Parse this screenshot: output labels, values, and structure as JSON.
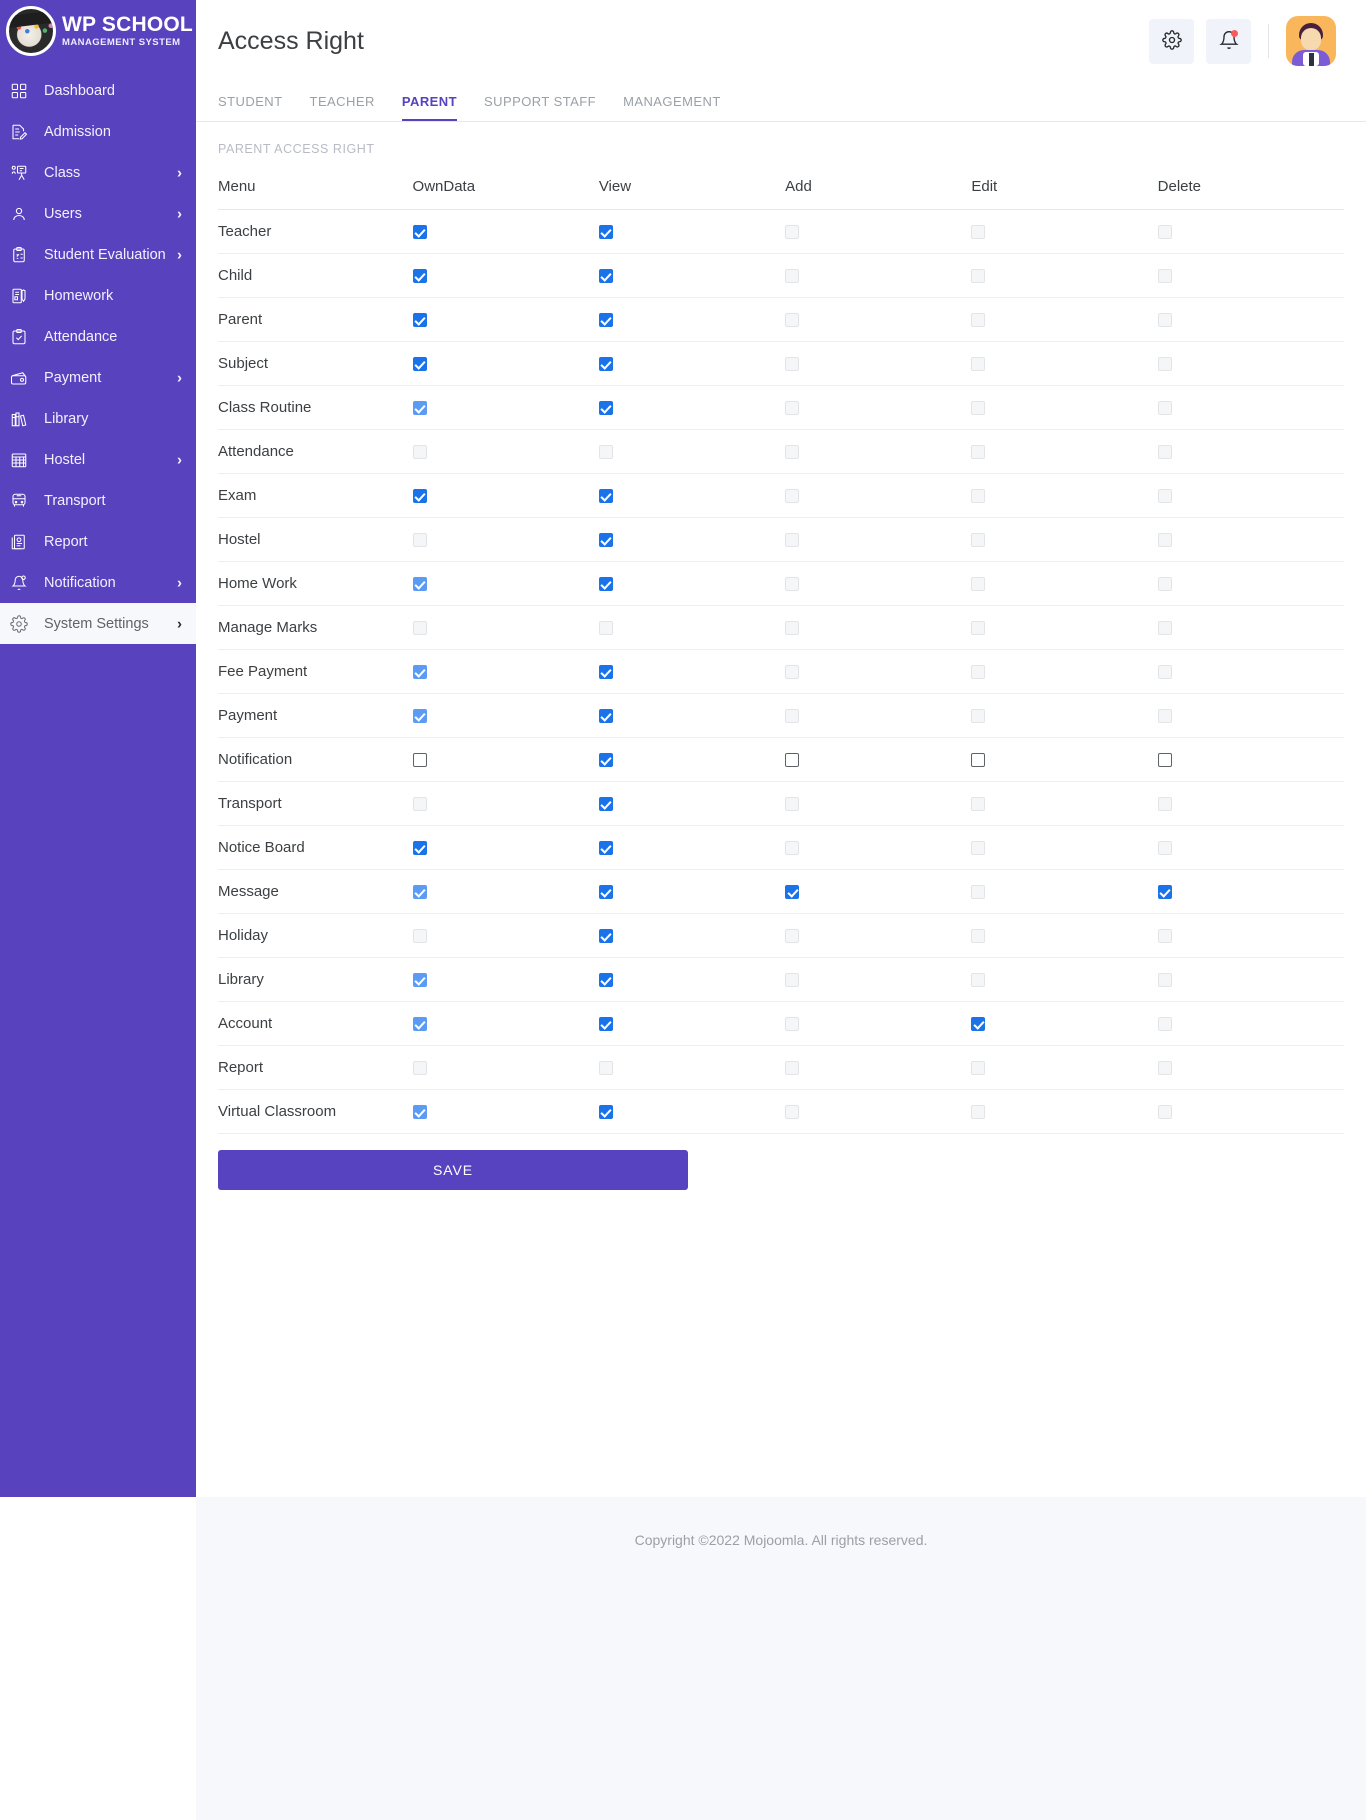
{
  "brand": {
    "title": "WP SCHOOL",
    "subtitle": "MANAGEMENT SYSTEM",
    "logo_icon": "graduation-cap-logo"
  },
  "sidebar": {
    "items": [
      {
        "label": "Dashboard",
        "icon": "grid-icon",
        "chevron": "",
        "active": false
      },
      {
        "label": "Admission",
        "icon": "document-pen-icon",
        "chevron": "",
        "active": false
      },
      {
        "label": "Class",
        "icon": "classroom-icon",
        "chevron": "›",
        "active": false
      },
      {
        "label": "Users",
        "icon": "user-icon",
        "chevron": "›",
        "active": false
      },
      {
        "label": "Student Evaluation",
        "icon": "clipboard-check-icon",
        "chevron": "›",
        "active": false
      },
      {
        "label": "Homework",
        "icon": "book-pen-icon",
        "chevron": "",
        "active": false
      },
      {
        "label": "Attendance",
        "icon": "clipboard-tick-icon",
        "chevron": "",
        "active": false
      },
      {
        "label": "Payment",
        "icon": "wallet-icon",
        "chevron": "›",
        "active": false
      },
      {
        "label": "Library",
        "icon": "books-icon",
        "chevron": "",
        "active": false
      },
      {
        "label": "Hostel",
        "icon": "hostel-icon",
        "chevron": "›",
        "active": false
      },
      {
        "label": "Transport",
        "icon": "bus-icon",
        "chevron": "",
        "active": false
      },
      {
        "label": "Report",
        "icon": "report-chart-icon",
        "chevron": "",
        "active": false
      },
      {
        "label": "Notification",
        "icon": "bell-icon",
        "chevron": "›",
        "active": false
      },
      {
        "label": "System Settings",
        "icon": "gear-icon",
        "chevron": "›",
        "active": true
      }
    ]
  },
  "header": {
    "title": "Access Right",
    "settings_icon": "gear-icon",
    "notification_icon": "bell-icon",
    "has_notification_dot": true,
    "avatar_icon": "user-avatar"
  },
  "tabs": [
    {
      "label": "STUDENT",
      "active": false
    },
    {
      "label": "TEACHER",
      "active": false
    },
    {
      "label": "PARENT",
      "active": true
    },
    {
      "label": "SUPPORT STAFF",
      "active": false
    },
    {
      "label": "MANAGEMENT",
      "active": false
    }
  ],
  "section_label": "PARENT ACCESS RIGHT",
  "table": {
    "columns": [
      "Menu",
      "OwnData",
      "View",
      "Add",
      "Edit",
      "Delete"
    ],
    "rows": [
      {
        "menu": "Teacher",
        "cells": [
          "checked",
          "checked",
          "off",
          "off",
          "off"
        ]
      },
      {
        "menu": "Child",
        "cells": [
          "checked",
          "checked",
          "off",
          "off",
          "off"
        ]
      },
      {
        "menu": "Parent",
        "cells": [
          "checked",
          "checked",
          "off",
          "off",
          "off"
        ]
      },
      {
        "menu": "Subject",
        "cells": [
          "checked",
          "checked",
          "off",
          "off",
          "off"
        ]
      },
      {
        "menu": "Class Routine",
        "cells": [
          "checked-light",
          "checked",
          "off",
          "off",
          "off"
        ]
      },
      {
        "menu": "Attendance",
        "cells": [
          "off",
          "off",
          "off",
          "off",
          "off"
        ]
      },
      {
        "menu": "Exam",
        "cells": [
          "checked",
          "checked",
          "off",
          "off",
          "off"
        ]
      },
      {
        "menu": "Hostel",
        "cells": [
          "off",
          "checked",
          "off",
          "off",
          "off"
        ]
      },
      {
        "menu": "Home Work",
        "cells": [
          "checked-light",
          "checked",
          "off",
          "off",
          "off"
        ]
      },
      {
        "menu": "Manage Marks",
        "cells": [
          "off",
          "off",
          "off",
          "off",
          "off"
        ]
      },
      {
        "menu": "Fee Payment",
        "cells": [
          "checked-light",
          "checked",
          "off",
          "off",
          "off"
        ]
      },
      {
        "menu": "Payment",
        "cells": [
          "checked-light",
          "checked",
          "off",
          "off",
          "off"
        ]
      },
      {
        "menu": "Notification",
        "cells": [
          "open",
          "checked",
          "open",
          "open",
          "open"
        ]
      },
      {
        "menu": "Transport",
        "cells": [
          "off",
          "checked",
          "off",
          "off",
          "off"
        ]
      },
      {
        "menu": "Notice Board",
        "cells": [
          "checked",
          "checked",
          "off",
          "off",
          "off"
        ]
      },
      {
        "menu": "Message",
        "cells": [
          "checked-light",
          "checked",
          "checked",
          "off",
          "checked"
        ]
      },
      {
        "menu": "Holiday",
        "cells": [
          "off",
          "checked",
          "off",
          "off",
          "off"
        ]
      },
      {
        "menu": "Library",
        "cells": [
          "checked-light",
          "checked",
          "off",
          "off",
          "off"
        ]
      },
      {
        "menu": "Account",
        "cells": [
          "checked-light",
          "checked",
          "off",
          "checked",
          "off"
        ]
      },
      {
        "menu": "Report",
        "cells": [
          "off",
          "off",
          "off",
          "off",
          "off"
        ]
      },
      {
        "menu": "Virtual Classroom",
        "cells": [
          "checked-light",
          "checked",
          "off",
          "off",
          "off"
        ]
      }
    ]
  },
  "save_label": "SAVE",
  "footer": {
    "text": "Copyright ©2022 Mojoomla. All rights reserved."
  },
  "colors": {
    "brand_purple": "#5842bd",
    "accent_purple": "#5742c0",
    "checkbox_blue": "#1a73e8",
    "checkbox_blue_light": "#5b9bf3"
  }
}
